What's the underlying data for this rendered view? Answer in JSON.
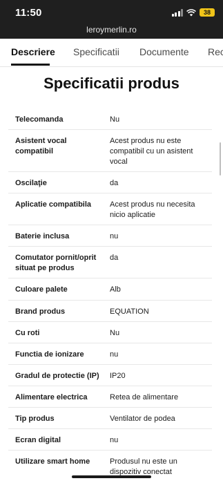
{
  "status_bar": {
    "time": "11:50",
    "battery": "38"
  },
  "browser": {
    "url": "leroymerlin.ro"
  },
  "tabs": [
    {
      "label": "Descriere"
    },
    {
      "label": "Specificatii"
    },
    {
      "label": "Documente"
    },
    {
      "label": "Rec"
    }
  ],
  "heading": "Specificatii produs",
  "specs": [
    {
      "key": "Telecomanda",
      "value": "Nu"
    },
    {
      "key": "Asistent vocal compatibil",
      "value": "Acest produs nu este compatibil cu un asistent vocal"
    },
    {
      "key": "Oscilaţie",
      "value": "da"
    },
    {
      "key": "Aplicatie compatibila",
      "value": "Acest produs nu necesita nicio aplicatie"
    },
    {
      "key": "Baterie inclusa",
      "value": "nu"
    },
    {
      "key": "Comutator pornit/oprit situat pe produs",
      "value": "da"
    },
    {
      "key": "Culoare palete",
      "value": "Alb"
    },
    {
      "key": "Brand produs",
      "value": "EQUATION"
    },
    {
      "key": "Cu roti",
      "value": "Nu"
    },
    {
      "key": "Functia de ionizare",
      "value": "nu"
    },
    {
      "key": "Gradul de protectie (IP)",
      "value": "IP20"
    },
    {
      "key": "Alimentare electrica",
      "value": "Retea de alimentare"
    },
    {
      "key": "Tip produs",
      "value": "Ventilator de podea"
    },
    {
      "key": "Ecran digital",
      "value": "nu"
    },
    {
      "key": "Utilizare smart home",
      "value": "Produsul nu este un dispozitiv conectat"
    }
  ]
}
